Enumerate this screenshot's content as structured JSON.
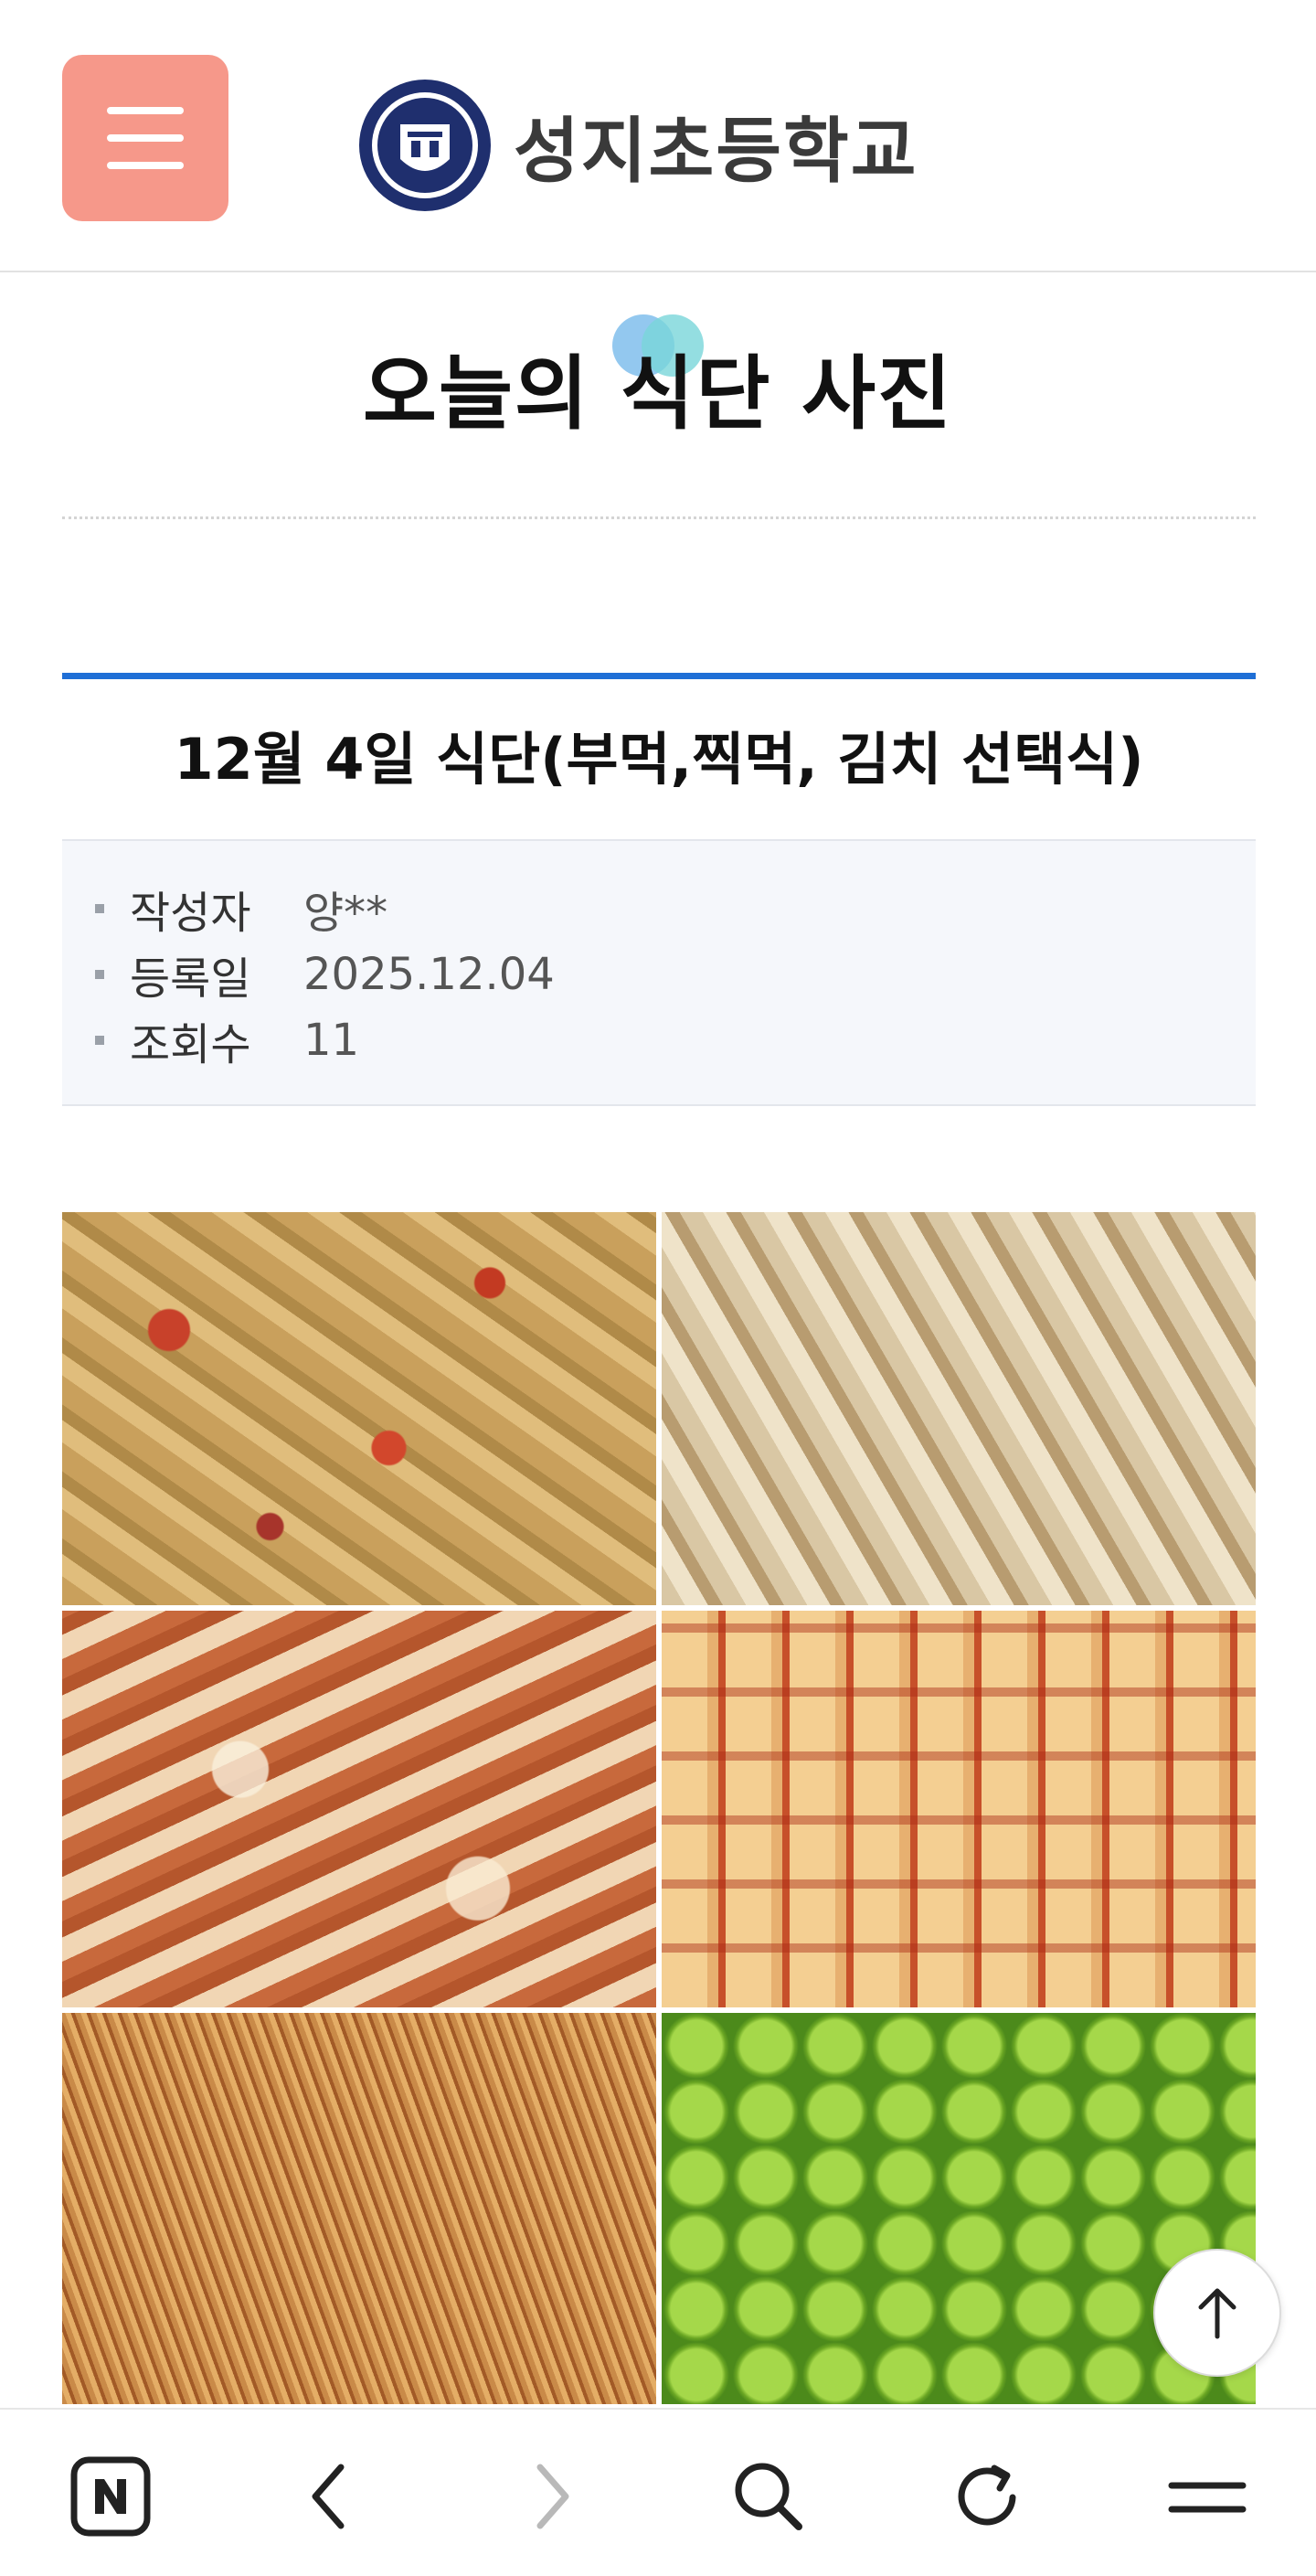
{
  "header": {
    "school_name": "성지초등학교",
    "menu_icon": "hamburger-menu-icon",
    "logo_icon": "school-emblem-icon"
  },
  "page": {
    "title": "오늘의 식단 사진"
  },
  "post": {
    "title": "12월 4일 식단(부먹,찍먹, 김치 선택식)",
    "meta": [
      {
        "label": "작성자",
        "value": "양**"
      },
      {
        "label": "등록일",
        "value": "2025.12.04"
      },
      {
        "label": "조회수",
        "value": "11"
      }
    ],
    "photos": [
      "sweet-and-sour-pork-with-sauce",
      "fried-pork-plain",
      "napa-cabbage-kimchi",
      "radish-kimchi",
      "seasoned-dried-radish-strips",
      "green-grapes"
    ]
  },
  "toolbar": {
    "icons": [
      "naver-n-icon",
      "back-arrow-icon",
      "forward-arrow-icon",
      "search-icon",
      "refresh-icon",
      "menu-icon"
    ]
  },
  "colors": {
    "menu_button": "#f6988a",
    "accent_rule": "#1f6fd6",
    "meta_background": "#f5f7fb"
  }
}
